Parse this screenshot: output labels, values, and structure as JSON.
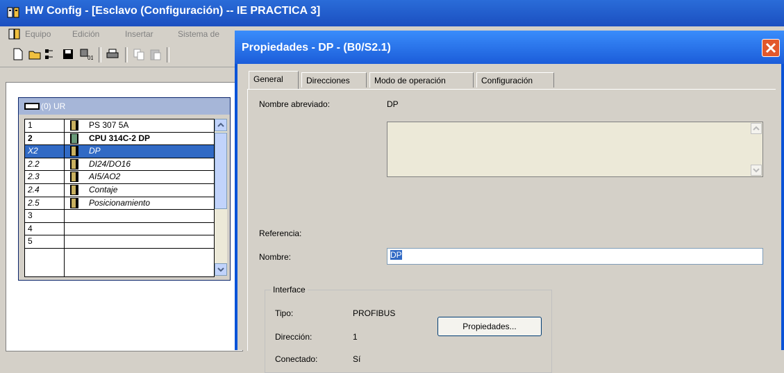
{
  "app": {
    "title": "HW Config - [Esclavo (Configuración) -- IE PRACTICA 3]",
    "menu": [
      "Equipo",
      "Edición",
      "Insertar",
      "Sistema de"
    ]
  },
  "rack": {
    "title": "(0) UR",
    "rows": [
      {
        "slot": "1",
        "module": "PS 307 5A"
      },
      {
        "slot": "2",
        "module": "CPU 314C-2 DP"
      },
      {
        "slot": "X2",
        "module": "DP"
      },
      {
        "slot": "2.2",
        "module": "DI24/DO16"
      },
      {
        "slot": "2.3",
        "module": "AI5/AO2"
      },
      {
        "slot": "2.4",
        "module": "Contaje"
      },
      {
        "slot": "2.5",
        "module": "Posicionamiento"
      },
      {
        "slot": "3",
        "module": ""
      },
      {
        "slot": "4",
        "module": ""
      },
      {
        "slot": "5",
        "module": ""
      }
    ]
  },
  "dialog": {
    "title": "Propiedades - DP - (B0/S2.1)",
    "tabs": [
      "General",
      "Direcciones",
      "Modo de operación",
      "Configuración"
    ],
    "short_name_label": "Nombre abreviado:",
    "short_name_value": "DP",
    "reference_label": "Referencia:",
    "name_label": "Nombre:",
    "name_value": "DP",
    "interface": {
      "legend": "Interface",
      "type_label": "Tipo:",
      "type_value": "PROFIBUS",
      "address_label": "Dirección:",
      "address_value": "1",
      "connected_label": "Conectado:",
      "connected_value": "Sí",
      "properties_button": "Propiedades..."
    }
  }
}
